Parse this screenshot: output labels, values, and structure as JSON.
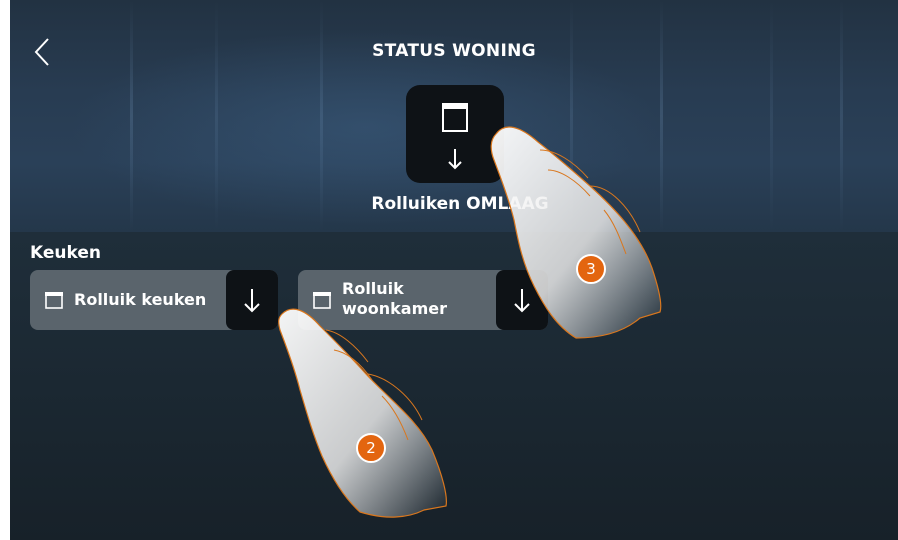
{
  "header": {
    "title": "STATUS WONING",
    "back_icon": "chevron-left-icon"
  },
  "main_action": {
    "icon": "shutter-icon",
    "arrow_icon": "arrow-down-icon",
    "label": "Rolluiken OMLAAG"
  },
  "room": {
    "name": "Keuken",
    "devices": [
      {
        "icon": "shutter-icon",
        "label": "Rolluik keuken",
        "action_icon": "arrow-down-icon"
      },
      {
        "icon": "shutter-icon",
        "label": "Rolluik woonkamer",
        "action_icon": "arrow-down-icon"
      }
    ]
  },
  "annotations": {
    "step_2": "2",
    "step_3": "3",
    "badge_color": "#e3650f"
  },
  "colors": {
    "tile_dark": "#0e1216",
    "card_grey": "#5a646c",
    "text": "#ffffff"
  }
}
